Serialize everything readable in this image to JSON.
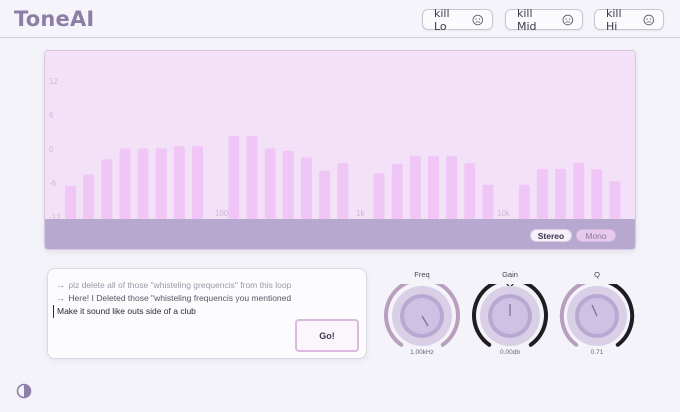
{
  "app": {
    "title": "ToneAI"
  },
  "header": {
    "buttons": [
      {
        "label": "kill Lo",
        "icon": "sad-face-icon"
      },
      {
        "label": "kill Mid",
        "icon": "sad-face-icon"
      },
      {
        "label": "kill Hi",
        "icon": "sad-face-icon"
      }
    ]
  },
  "chart_data": {
    "type": "bar",
    "y_ticks": [
      "12",
      "6",
      "0",
      "-6",
      "-12"
    ],
    "ylim": [
      -12,
      12
    ],
    "x_ticks": [
      "100",
      "1k",
      "10k"
    ],
    "x_scale": "log",
    "values": [
      -6.5,
      -4.5,
      -1.8,
      0.1,
      0.1,
      0.1,
      0.5,
      0.5,
      -12,
      2.3,
      2.3,
      0.1,
      -0.3,
      -1.5,
      -3.8,
      -2.5,
      -12,
      -4.3,
      -2.6,
      -1.2,
      -1.2,
      -1.2,
      -2.5,
      -6.3,
      -12,
      -6.3,
      -3.5,
      -3.5,
      -2.4,
      -3.6,
      -5.7
    ],
    "colors": {
      "bar": "#f0c6f6",
      "background": "#f3e1f8",
      "tick_text": "#cdb8d8"
    }
  },
  "view_toggle": {
    "stereo": "Stereo",
    "mono": "Mono",
    "selected": "Stereo"
  },
  "chat": {
    "messages": [
      {
        "text": "plz delete all of those \"whisteling grequencis\" from this loop"
      },
      {
        "text": "Here! I Deleted those \"whisteling frequencis you mentioned"
      }
    ],
    "input_value": "Make it sound like outs side of a club",
    "go_label": "Go!"
  },
  "knobs": [
    {
      "label": "Freq",
      "value": "1.00kHz",
      "level": 0.36
    },
    {
      "label": "Gain",
      "value": "0.00db",
      "level": 0.5
    },
    {
      "label": "Q",
      "value": "0.71",
      "level": 0.42
    }
  ],
  "footer": {
    "theme_icon": "contrast-icon"
  }
}
